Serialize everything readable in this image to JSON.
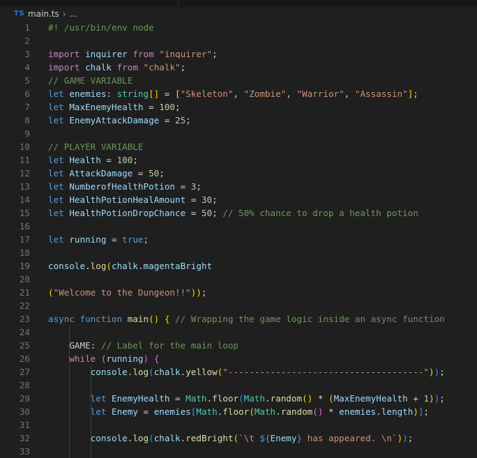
{
  "breadcrumb": {
    "file_icon": "TS",
    "file_name": "main.ts",
    "chevron": "›",
    "more": "..."
  },
  "editor": {
    "lines": [
      {
        "n": "1",
        "tokens": [
          [
            "com",
            "#! /usr/bin/env node"
          ]
        ]
      },
      {
        "n": "2",
        "tokens": []
      },
      {
        "n": "3",
        "tokens": [
          [
            "kw",
            "import "
          ],
          [
            "var",
            "inquirer"
          ],
          [
            "pun",
            " "
          ],
          [
            "kw",
            "from"
          ],
          [
            "pun",
            " "
          ],
          [
            "st",
            "\"inquirer\""
          ],
          [
            "pun",
            ";"
          ]
        ]
      },
      {
        "n": "4",
        "tokens": [
          [
            "kw",
            "import "
          ],
          [
            "var",
            "chalk"
          ],
          [
            "pun",
            " "
          ],
          [
            "kw",
            "from"
          ],
          [
            "pun",
            " "
          ],
          [
            "st",
            "\"chalk\""
          ],
          [
            "pun",
            ";"
          ]
        ]
      },
      {
        "n": "5",
        "tokens": [
          [
            "com",
            "// GAME VARIABLE"
          ]
        ]
      },
      {
        "n": "6",
        "tokens": [
          [
            "dec",
            "let "
          ],
          [
            "var",
            "enemies"
          ],
          [
            "pun",
            ": "
          ],
          [
            "type",
            "string"
          ],
          [
            "b1",
            "[]"
          ],
          [
            "pun",
            " = "
          ],
          [
            "b1",
            "["
          ],
          [
            "st",
            "\"Skeleton\""
          ],
          [
            "pun",
            ", "
          ],
          [
            "st",
            "\"Zombie\""
          ],
          [
            "pun",
            ", "
          ],
          [
            "st",
            "\"Warrior\""
          ],
          [
            "pun",
            ", "
          ],
          [
            "st",
            "\"Assassin\""
          ],
          [
            "b1",
            "]"
          ],
          [
            "pun",
            ";"
          ]
        ]
      },
      {
        "n": "7",
        "tokens": [
          [
            "dec",
            "let "
          ],
          [
            "var",
            "MaxEnemyHealth"
          ],
          [
            "pun",
            " = "
          ],
          [
            "num",
            "100"
          ],
          [
            "pun",
            ";"
          ]
        ]
      },
      {
        "n": "8",
        "tokens": [
          [
            "dec",
            "let "
          ],
          [
            "var",
            "EnemyAttackDamage"
          ],
          [
            "pun",
            " = "
          ],
          [
            "num",
            "25"
          ],
          [
            "pun",
            ";"
          ]
        ]
      },
      {
        "n": "9",
        "tokens": []
      },
      {
        "n": "10",
        "tokens": [
          [
            "com",
            "// PLAYER VARIABLE"
          ]
        ]
      },
      {
        "n": "11",
        "tokens": [
          [
            "dec",
            "let "
          ],
          [
            "var",
            "Health"
          ],
          [
            "pun",
            " = "
          ],
          [
            "num",
            "100"
          ],
          [
            "pun",
            ";"
          ]
        ]
      },
      {
        "n": "12",
        "tokens": [
          [
            "dec",
            "let "
          ],
          [
            "var",
            "AttackDamage"
          ],
          [
            "pun",
            " = "
          ],
          [
            "num",
            "50"
          ],
          [
            "pun",
            ";"
          ]
        ]
      },
      {
        "n": "13",
        "tokens": [
          [
            "dec",
            "let "
          ],
          [
            "var",
            "NumberofHealthPotion"
          ],
          [
            "pun",
            " = "
          ],
          [
            "num",
            "3"
          ],
          [
            "pun",
            ";"
          ]
        ]
      },
      {
        "n": "14",
        "tokens": [
          [
            "dec",
            "let "
          ],
          [
            "var",
            "HealthPotionHealAmount"
          ],
          [
            "pun",
            " = "
          ],
          [
            "num",
            "30"
          ],
          [
            "pun",
            ";"
          ]
        ]
      },
      {
        "n": "15",
        "tokens": [
          [
            "dec",
            "let "
          ],
          [
            "var",
            "HealthPotionDropChance"
          ],
          [
            "pun",
            " = "
          ],
          [
            "num",
            "50"
          ],
          [
            "pun",
            "; "
          ],
          [
            "com",
            "// 50% chance to drop a health potion"
          ]
        ]
      },
      {
        "n": "16",
        "tokens": []
      },
      {
        "n": "17",
        "tokens": [
          [
            "dec",
            "let "
          ],
          [
            "var",
            "running"
          ],
          [
            "pun",
            " = "
          ],
          [
            "dec",
            "true"
          ],
          [
            "pun",
            ";"
          ]
        ]
      },
      {
        "n": "18",
        "tokens": []
      },
      {
        "n": "19",
        "tokens": [
          [
            "var",
            "console"
          ],
          [
            "pun",
            "."
          ],
          [
            "fn",
            "log"
          ],
          [
            "b1",
            "("
          ],
          [
            "var",
            "chalk"
          ],
          [
            "pun",
            "."
          ],
          [
            "var",
            "magentaBright"
          ]
        ]
      },
      {
        "n": "20",
        "tokens": []
      },
      {
        "n": "21",
        "tokens": [
          [
            "b1",
            "("
          ],
          [
            "st",
            "\"Welcome to the Dungeon!!\""
          ],
          [
            "b1",
            "))"
          ],
          [
            "pun",
            ";"
          ]
        ]
      },
      {
        "n": "22",
        "tokens": []
      },
      {
        "n": "23",
        "tokens": [
          [
            "dec",
            "async "
          ],
          [
            "dec",
            "function "
          ],
          [
            "fn",
            "main"
          ],
          [
            "b1",
            "()"
          ],
          [
            "pun",
            " "
          ],
          [
            "b1",
            "{"
          ],
          [
            "pun",
            " "
          ],
          [
            "com",
            "// Wrapping the game logic inside an async function"
          ]
        ]
      },
      {
        "n": "24",
        "tokens": []
      },
      {
        "n": "25",
        "tokens": [
          [
            "pun",
            "    "
          ],
          [
            "lbl",
            "GAME"
          ],
          [
            "pun",
            ": "
          ],
          [
            "com",
            "// Label for the main loop"
          ]
        ]
      },
      {
        "n": "26",
        "tokens": [
          [
            "pun",
            "    "
          ],
          [
            "kw",
            "while "
          ],
          [
            "b2",
            "("
          ],
          [
            "var",
            "running"
          ],
          [
            "b2",
            ")"
          ],
          [
            "pun",
            " "
          ],
          [
            "b2",
            "{"
          ]
        ]
      },
      {
        "n": "27",
        "tokens": [
          [
            "pun",
            "        "
          ],
          [
            "var",
            "console"
          ],
          [
            "pun",
            "."
          ],
          [
            "fn",
            "log"
          ],
          [
            "b3",
            "("
          ],
          [
            "var",
            "chalk"
          ],
          [
            "pun",
            "."
          ],
          [
            "fn",
            "yellow"
          ],
          [
            "b1",
            "("
          ],
          [
            "st",
            "\"-------------------------------------\""
          ],
          [
            "b1",
            ")"
          ],
          [
            "b3",
            ")"
          ],
          [
            "pun",
            ";"
          ]
        ]
      },
      {
        "n": "28",
        "tokens": []
      },
      {
        "n": "29",
        "tokens": [
          [
            "pun",
            "        "
          ],
          [
            "dec",
            "let "
          ],
          [
            "var",
            "EnemyHealth"
          ],
          [
            "pun",
            " = "
          ],
          [
            "type",
            "Math"
          ],
          [
            "pun",
            "."
          ],
          [
            "fn",
            "floor"
          ],
          [
            "b3",
            "("
          ],
          [
            "type",
            "Math"
          ],
          [
            "pun",
            "."
          ],
          [
            "fn",
            "random"
          ],
          [
            "b1",
            "()"
          ],
          [
            "pun",
            " * "
          ],
          [
            "b1",
            "("
          ],
          [
            "var",
            "MaxEnemyHealth"
          ],
          [
            "pun",
            " + "
          ],
          [
            "num",
            "1"
          ],
          [
            "b1",
            ")"
          ],
          [
            "b3",
            ")"
          ],
          [
            "pun",
            ";"
          ]
        ]
      },
      {
        "n": "30",
        "tokens": [
          [
            "pun",
            "        "
          ],
          [
            "dec",
            "let "
          ],
          [
            "var",
            "Enemy"
          ],
          [
            "pun",
            " = "
          ],
          [
            "var",
            "enemies"
          ],
          [
            "b3",
            "["
          ],
          [
            "type",
            "Math"
          ],
          [
            "pun",
            "."
          ],
          [
            "fn",
            "floor"
          ],
          [
            "b1",
            "("
          ],
          [
            "type",
            "Math"
          ],
          [
            "pun",
            "."
          ],
          [
            "fn",
            "random"
          ],
          [
            "b2",
            "()"
          ],
          [
            "pun",
            " * "
          ],
          [
            "var",
            "enemies"
          ],
          [
            "pun",
            "."
          ],
          [
            "var",
            "length"
          ],
          [
            "b1",
            ")"
          ],
          [
            "b3",
            "]"
          ],
          [
            "pun",
            ";"
          ]
        ]
      },
      {
        "n": "31",
        "tokens": []
      },
      {
        "n": "32",
        "tokens": [
          [
            "pun",
            "        "
          ],
          [
            "var",
            "console"
          ],
          [
            "pun",
            "."
          ],
          [
            "fn",
            "log"
          ],
          [
            "b3",
            "("
          ],
          [
            "var",
            "chalk"
          ],
          [
            "pun",
            "."
          ],
          [
            "fn",
            "redBright"
          ],
          [
            "b1",
            "("
          ],
          [
            "st",
            "`\\t "
          ],
          [
            "dec",
            "${"
          ],
          [
            "var",
            "Enemy"
          ],
          [
            "dec",
            "}"
          ],
          [
            "st",
            " has appeared. \\n`"
          ],
          [
            "b1",
            ")"
          ],
          [
            "b3",
            ")"
          ],
          [
            "pun",
            ";"
          ]
        ]
      },
      {
        "n": "33",
        "tokens": []
      }
    ]
  }
}
